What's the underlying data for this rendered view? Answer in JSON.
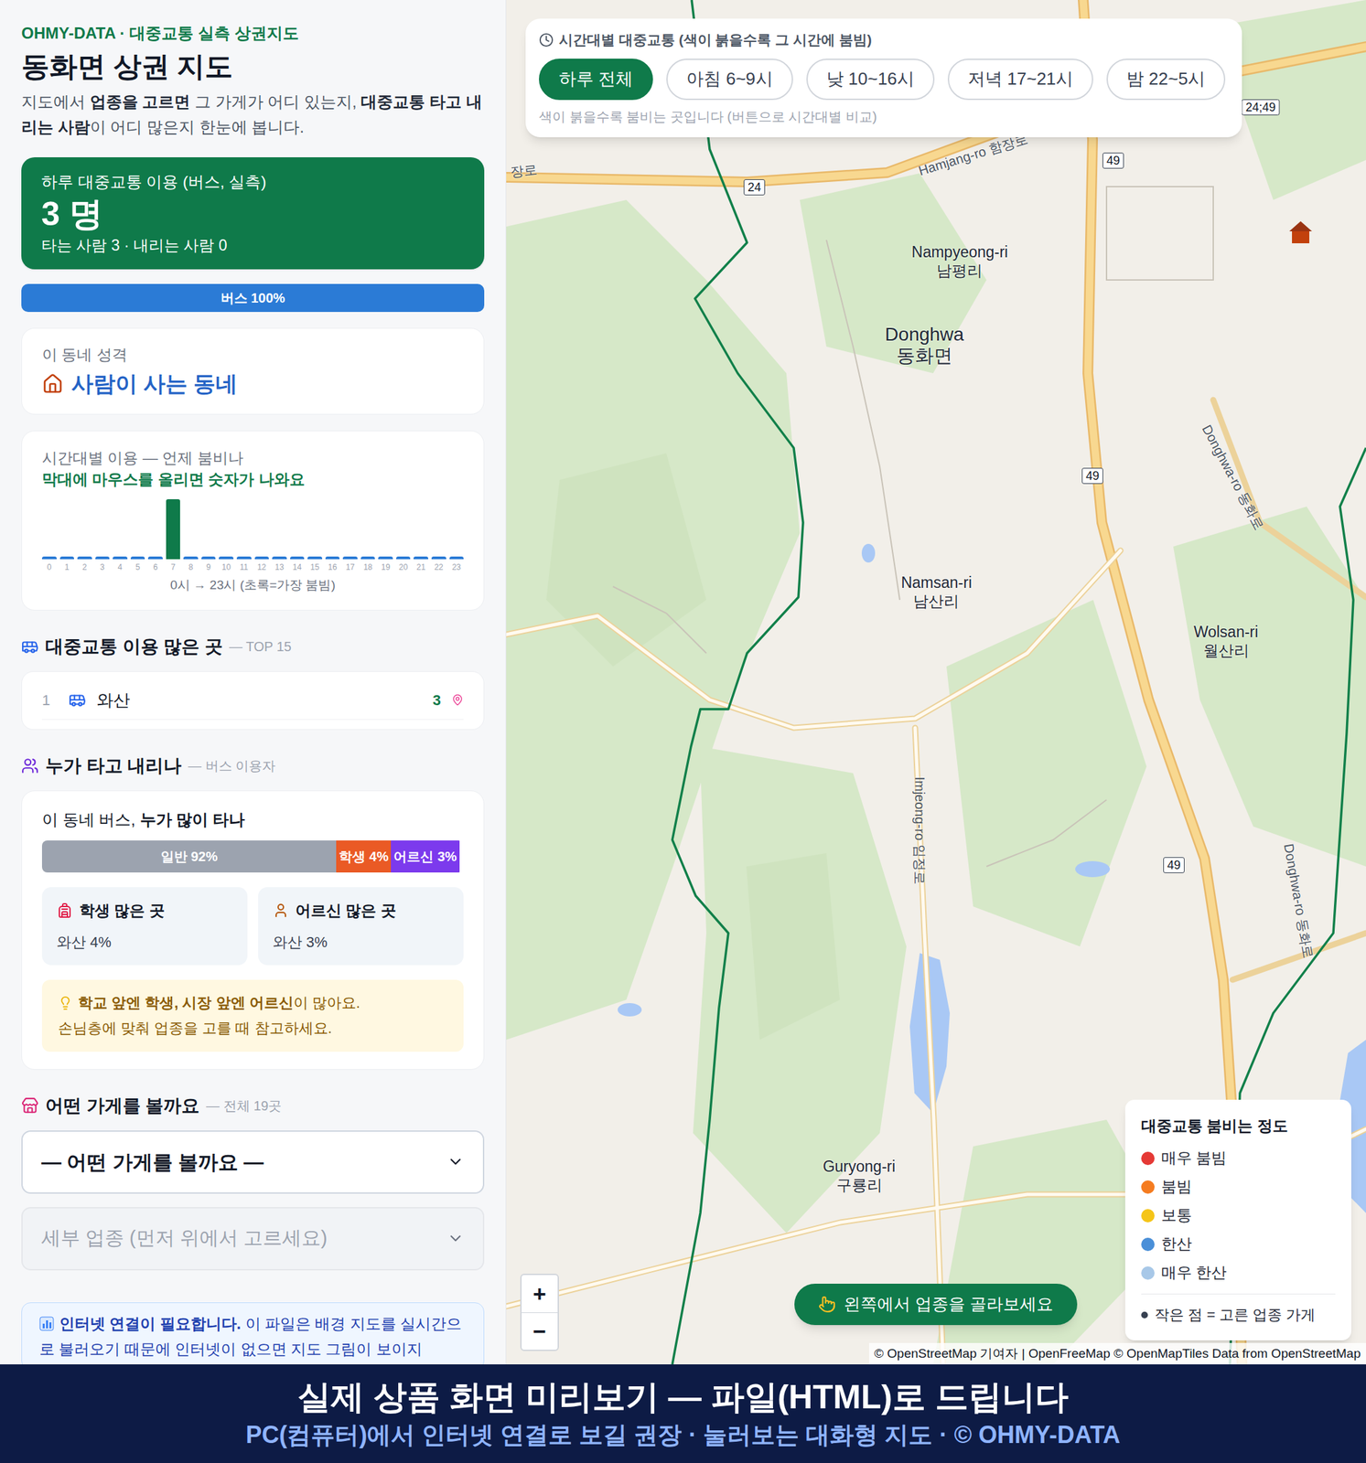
{
  "sidebar": {
    "brand": "OHMY-DATA · 대중교통 실측 상권지도",
    "title": "동화면 상권 지도",
    "description": [
      {
        "text": "지도에서 ",
        "bold": false
      },
      {
        "text": "업종을 고르면",
        "bold": true
      },
      {
        "text": " 그 가게가 어디 있는지, ",
        "bold": false
      },
      {
        "text": "대중교통 타고 내리는 사람",
        "bold": true
      },
      {
        "text": "이 어디 많은지 한눈에 봅니다.",
        "bold": false
      }
    ],
    "summary": {
      "label": "하루 대중교통 이용 (버스, 실측)",
      "value": "3 명",
      "detail": "타는 사람 3 · 내리는 사람 0"
    },
    "mode_bar": [
      {
        "label": "버스 100%",
        "level": 1,
        "color": "#2b7bd6"
      }
    ],
    "character": {
      "label": "이 동네 성격",
      "value": "사람이 사는 동네"
    },
    "hourly": {
      "title": "시간대별 이용 — 언제 붐비나",
      "hint": "막대에 마우스를 올리면 숫자가 나와요",
      "values": [
        0,
        0,
        0,
        0,
        0,
        0,
        0,
        3,
        0,
        0,
        0,
        0,
        0,
        0,
        0,
        0,
        0,
        0,
        0,
        0,
        0,
        0,
        0,
        0
      ],
      "ticks": [
        "0",
        "1",
        "2",
        "3",
        "4",
        "5",
        "6",
        "7",
        "8",
        "9",
        "10",
        "11",
        "12",
        "13",
        "14",
        "15",
        "16",
        "17",
        "18",
        "19",
        "20",
        "21",
        "22",
        "23"
      ],
      "caption": "0시 → 23시 (초록=가장 붐빔)"
    },
    "top_stops": {
      "title": "대중교통 이용 많은 곳",
      "note": "— TOP 15",
      "items": [
        {
          "rank": "1",
          "name": "와산",
          "count": "3"
        }
      ]
    },
    "riders": {
      "title": "누가 타고 내리나",
      "note": "— 버스 이용자",
      "heading": [
        {
          "text": "이 동네 버스, ",
          "bold": false
        },
        {
          "text": "누가 많이 타나",
          "bold": true
        }
      ],
      "shares": [
        {
          "label": "일반 92%",
          "level": 0.92,
          "color": "#9ca3af"
        },
        {
          "label": "학생 4%",
          "level": 0.04,
          "color": "#ea5a25"
        },
        {
          "label": "어르신 3%",
          "level": 0.03,
          "color": "#7c3aed"
        }
      ],
      "cards": [
        {
          "kind": "student",
          "title": "학생 많은 곳",
          "value": "와산 4%"
        },
        {
          "kind": "senior",
          "title": "어르신 많은 곳",
          "value": "와산 3%"
        }
      ],
      "tip": [
        [
          {
            "text": "학교 앞엔 학생, 시장 앞엔 어르신",
            "bold": true
          },
          {
            "text": "이 많아요.",
            "bold": false
          }
        ],
        [
          {
            "text": "손님층에 맞춰 업종을 고를 때 참고하세요.",
            "bold": false
          }
        ]
      ]
    },
    "shop_picker": {
      "title": "어떤 가게를 볼까요",
      "note": "— 전체 19곳",
      "category": {
        "value": "— 어떤 가게를 볼까요 —",
        "disabled": false
      },
      "subcategory": {
        "placeholder": "세부 업종 (먼저 위에서 고르세요)",
        "disabled": true
      }
    },
    "notice": [
      {
        "text": "인터넷 연결이 필요합니다.",
        "bold": true
      },
      {
        "text": " 이 파일은 배경 지도를 실시간으로 불러오기 때문에 인터넷이 없으면 지도 그림이 보이지",
        "bold": false
      }
    ]
  },
  "time_filter": {
    "title": "시간대별 대중교통 (색이 붉을수록 그 시간에 붐빔)",
    "buttons": [
      {
        "label": "하루 전체",
        "selected": true
      },
      {
        "label": "아침 6~9시",
        "selected": false
      },
      {
        "label": "낮 10~16시",
        "selected": false
      },
      {
        "label": "저녁 17~21시",
        "selected": false
      },
      {
        "label": "밤 22~5시",
        "selected": false
      }
    ],
    "caption": "색이 붉을수록 붐비는 곳입니다 (버튼으로 시간대별 비교)"
  },
  "map": {
    "places": [
      {
        "kind": "village",
        "en": "Nampyeong-ri",
        "ko": "남평리"
      },
      {
        "kind": "town",
        "en": "Donghwa",
        "ko": "동화면"
      },
      {
        "kind": "village",
        "en": "Namsan-ri",
        "ko": "남산리"
      },
      {
        "kind": "village",
        "en": "Wolsan-ri",
        "ko": "월산리"
      },
      {
        "kind": "village",
        "en": "Guryong-ri",
        "ko": "구룡리"
      }
    ],
    "roads": [
      "Hamjang-ro 함장로",
      "Donghwa-ro 동화로",
      "Donghwa-ro 동화로",
      "Imjeong-ro 임정로",
      "장로"
    ],
    "shields": [
      "24",
      "49",
      "49",
      "49",
      "24;49"
    ],
    "attribution": "© OpenStreetMap 기여자 | OpenFreeMap © OpenMapTiles Data from OpenStreetMap"
  },
  "legend": {
    "title": "대중교통 붐비는 정도",
    "items": [
      {
        "label": "매우 붐빔",
        "color": "#e53935"
      },
      {
        "label": "붐빔",
        "color": "#f57c20"
      },
      {
        "label": "보통",
        "color": "#f5c518"
      },
      {
        "label": "한산",
        "color": "#4a8fd8"
      },
      {
        "label": "매우 한산",
        "color": "#a8c8e8"
      }
    ],
    "note": "작은 점 = 고른 업종 가게"
  },
  "zoom": [
    "+",
    "−"
  ],
  "hint_button": "왼쪽에서 업종을 골라보세요",
  "banner": {
    "title": "실제 상품 화면 미리보기 — 파일(HTML)로 드립니다",
    "subtitle": "PC(컴퓨터)에서 인터넷 연결로 보길 권장 · 눌러보는 대화형 지도 · © OHMY-DATA"
  }
}
